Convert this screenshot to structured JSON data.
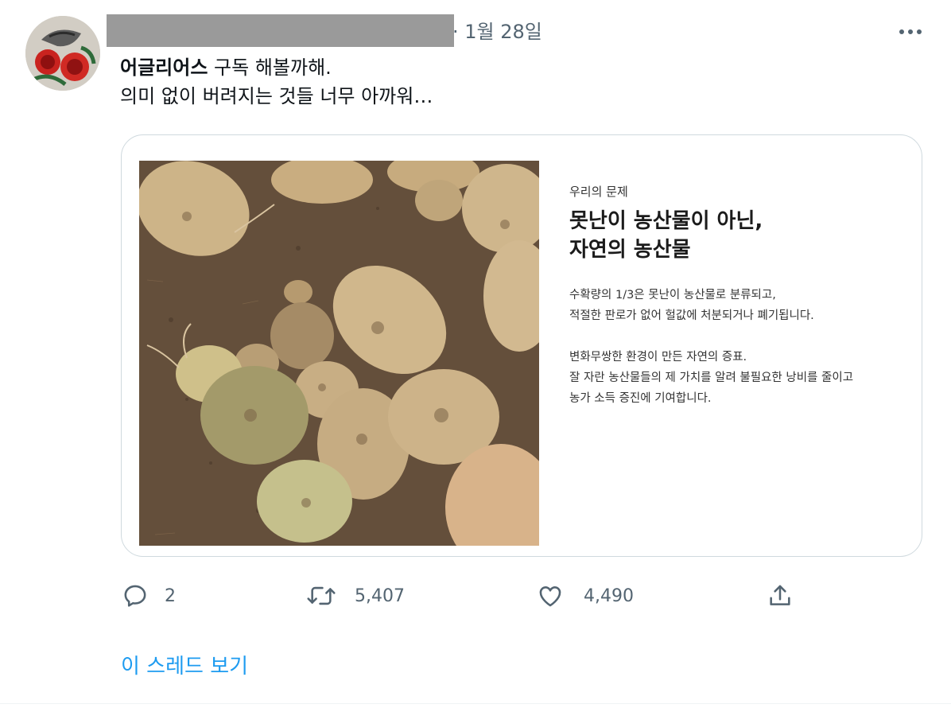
{
  "tweet": {
    "date": "· 1월 28일",
    "author_mention": "어글리어스",
    "text_line1_rest": " 구독 해볼까해.",
    "text_line2": "의미 없이 버려지는 것들 너무 아까워…",
    "more_icon": "more-horizontal-icon"
  },
  "card": {
    "kicker": "우리의 문제",
    "headline_line1": "못난이 농산물이 아닌,",
    "headline_line2": "자연의 농산물",
    "para1_line1": "수확량의 1/3은 못난이 농산물로 분류되고,",
    "para1_line2": "적절한 판로가 없어 헐값에 처분되거나 폐기됩니다.",
    "para2_line1": "변화무쌍한 환경이 만든 자연의 증표.",
    "para2_line2": "잘 자란 농산물들의 제 가치를 알려 불필요한 낭비를 줄이고",
    "para2_line3": "농가 소득 증진에 기여합니다."
  },
  "actions": {
    "reply_count": "2",
    "retweet_count": "5,407",
    "like_count": "4,490"
  },
  "thread_link": "이 스레드 보기",
  "colors": {
    "link": "#1d9bf0",
    "secondary_text": "#536471",
    "border": "#cfd9de"
  }
}
